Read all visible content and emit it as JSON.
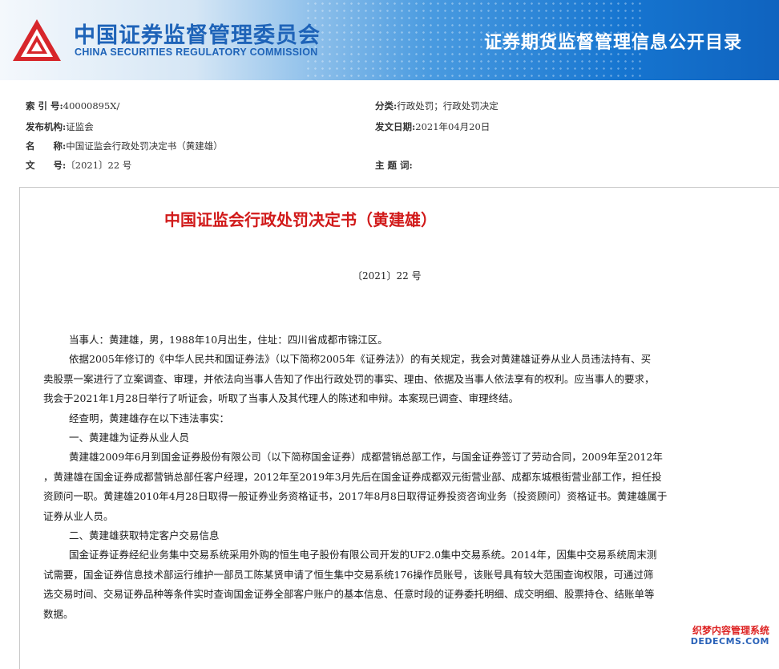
{
  "header": {
    "org_name_cn": "中国证券监督管理委员会",
    "org_name_en": "CHINA SECURITIES REGULATORY COMMISSION",
    "directory_title": "证券期货监督管理信息公开目录"
  },
  "meta": {
    "index_label": "索 引 号:",
    "index_value": "40000895X/",
    "category_label": "分类:",
    "category_value": "行政处罚；行政处罚决定",
    "issuer_label": "发布机构:",
    "issuer_value": "证监会",
    "date_label": "发文日期:",
    "date_value": "2021年04月20日",
    "name_label": "名　　称:",
    "name_value": "中国证监会行政处罚决定书（黄建雄）",
    "doc_no_label": "文　　号:",
    "doc_no_value": "〔2021〕22 号",
    "subject_label": "主 题 词:",
    "subject_value": ""
  },
  "document": {
    "title": "中国证监会行政处罚决定书（黄建雄）",
    "number": "〔2021〕22 号",
    "p1": "当事人：黄建雄，男，1988年10月出生，住址：四川省成都市锦江区。",
    "p2_l1": "依据2005年修订的《中华人民共和国证券法》（以下简称2005年《证券法》）的有关规定，我会对黄建雄证券从业人员违法持有、买",
    "p2_l2": "卖股票一案进行了立案调查、审理，并依法向当事人告知了作出行政处罚的事实、理由、依据及当事人依法享有的权利。应当事人的要求，",
    "p2_l3": "我会于2021年1月28日举行了听证会，听取了当事人及其代理人的陈述和申辩。本案现已调查、审理终结。",
    "p3": "经查明，黄建雄存在以下违法事实：",
    "h1": "一、黄建雄为证券从业人员",
    "p4_l1": "黄建雄2009年6月到国金证券股份有限公司（以下简称国金证券）成都营销总部工作，与国金证券签订了劳动合同，2009年至2012年",
    "p4_l2": "，黄建雄在国金证券成都营销总部任客户经理，2012年至2019年3月先后在国金证券成都双元街营业部、成都东城根街营业部工作，担任投",
    "p4_l3": "资顾问一职。黄建雄2010年4月28日取得一般证券业务资格证书，2017年8月8日取得证券投资咨询业务（投资顾问）资格证书。黄建雄属于",
    "p4_l4": "证券从业人员。",
    "h2": "二、黄建雄获取特定客户交易信息",
    "p5_l1": "国金证券证券经纪业务集中交易系统采用外购的恒生电子股份有限公司开发的UF2.0集中交易系统。2014年，因集中交易系统周末测",
    "p5_l2": "试需要，国金证券信息技术部运行维护一部员工陈某贤申请了恒生集中交易系统176操作员账号，该账号具有较大范围查询权限，可通过筛",
    "p5_l3": "选交易时间、交易证券品种等条件实时查询国金证券全部客户账户的基本信息、任意时段的证券委托明细、成交明细、股票持仓、结账单等",
    "p5_l4": "数据。"
  },
  "watermark": {
    "line1": "织梦内容管理系统",
    "line2": "DEDECMS.COM"
  },
  "colors": {
    "title_red": "#d11a1a",
    "brand_blue": "#1e63b8",
    "logo_red": "#d7262b"
  }
}
